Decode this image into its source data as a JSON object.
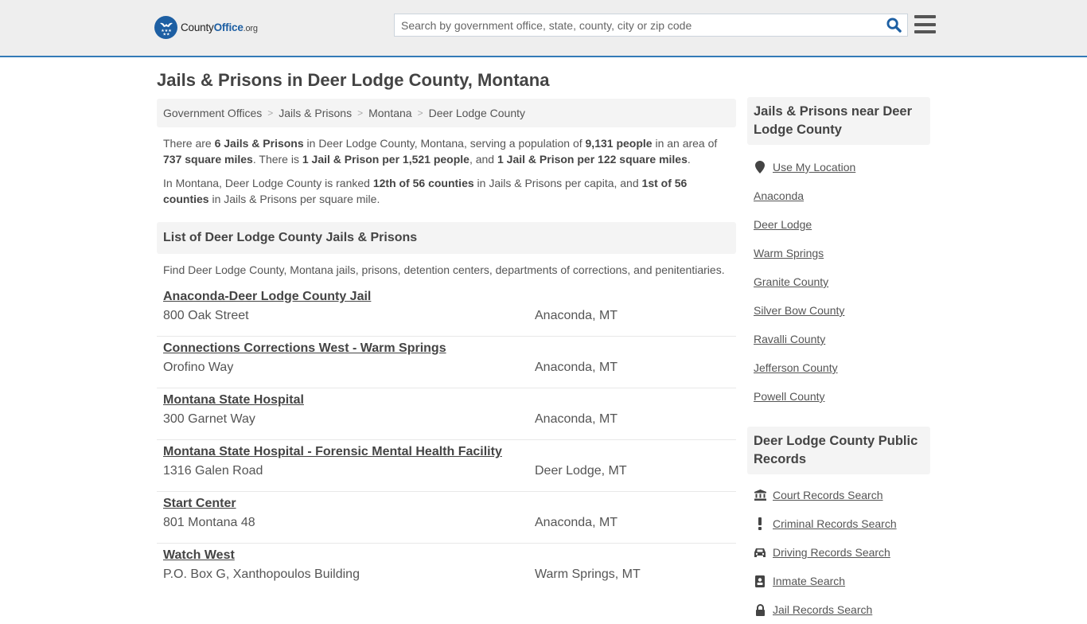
{
  "header": {
    "logo": {
      "county": "County",
      "office": "Office",
      "org": ".org"
    },
    "search": {
      "placeholder": "Search by government office, state, county, city or zip code",
      "value": ""
    },
    "colors": {
      "accent": "#337ab7",
      "brand": "#1d5fa3"
    }
  },
  "page_title": "Jails & Prisons in Deer Lodge County, Montana",
  "breadcrumb": [
    {
      "label": "Government Offices"
    },
    {
      "label": "Jails & Prisons"
    },
    {
      "label": "Montana"
    },
    {
      "label": "Deer Lodge County"
    }
  ],
  "breadcrumb_separator": ">",
  "intro": {
    "p1": [
      {
        "t": "There are ",
        "b": false
      },
      {
        "t": "6 Jails & Prisons",
        "b": true
      },
      {
        "t": " in Deer Lodge County, Montana, serving a population of ",
        "b": false
      },
      {
        "t": "9,131 people",
        "b": true
      },
      {
        "t": " in an area of ",
        "b": false
      },
      {
        "t": "737 square miles",
        "b": true
      },
      {
        "t": ". There is ",
        "b": false
      },
      {
        "t": "1 Jail & Prison per 1,521 people",
        "b": true
      },
      {
        "t": ", and ",
        "b": false
      },
      {
        "t": "1 Jail & Prison per 122 square miles",
        "b": true
      },
      {
        "t": ".",
        "b": false
      }
    ],
    "p2": [
      {
        "t": "In Montana, Deer Lodge County is ranked ",
        "b": false
      },
      {
        "t": "12th of 56 counties",
        "b": true
      },
      {
        "t": " in Jails & Prisons per capita, and ",
        "b": false
      },
      {
        "t": "1st of 56 counties",
        "b": true
      },
      {
        "t": " in Jails & Prisons per square mile.",
        "b": false
      }
    ]
  },
  "list": {
    "title": "List of Deer Lodge County Jails & Prisons",
    "description": "Find Deer Lodge County, Montana jails, prisons, detention centers, departments of corrections, and penitentiaries.",
    "entries": [
      {
        "name": "Anaconda-Deer Lodge County Jail",
        "address": "800 Oak Street",
        "city": "Anaconda, MT"
      },
      {
        "name": "Connections Corrections West - Warm Springs",
        "address": "Orofino Way",
        "city": "Anaconda, MT"
      },
      {
        "name": "Montana State Hospital",
        "address": "300 Garnet Way",
        "city": "Anaconda, MT"
      },
      {
        "name": "Montana State Hospital - Forensic Mental Health Facility",
        "address": "1316 Galen Road",
        "city": "Deer Lodge, MT"
      },
      {
        "name": "Start Center",
        "address": "801 Montana 48",
        "city": "Anaconda, MT"
      },
      {
        "name": "Watch West",
        "address": "P.O. Box G, Xanthopoulos Building",
        "city": "Warm Springs, MT"
      }
    ]
  },
  "sidebar": {
    "nearby_title": "Jails & Prisons near Deer Lodge County",
    "use_location": {
      "label": "Use My Location",
      "icon": "map-marker-icon"
    },
    "nearby": [
      {
        "label": "Anaconda"
      },
      {
        "label": "Deer Lodge"
      },
      {
        "label": "Warm Springs"
      },
      {
        "label": "Granite County"
      },
      {
        "label": "Silver Bow County"
      },
      {
        "label": "Ravalli County"
      },
      {
        "label": "Jefferson County"
      },
      {
        "label": "Powell County"
      }
    ],
    "records_title": "Deer Lodge County Public Records",
    "records": [
      {
        "label": "Court Records Search",
        "icon": "courthouse-icon"
      },
      {
        "label": "Criminal Records Search",
        "icon": "exclamation-icon"
      },
      {
        "label": "Driving Records Search",
        "icon": "car-icon"
      },
      {
        "label": "Inmate Search",
        "icon": "id-badge-icon"
      },
      {
        "label": "Jail Records Search",
        "icon": "lock-icon"
      }
    ]
  }
}
